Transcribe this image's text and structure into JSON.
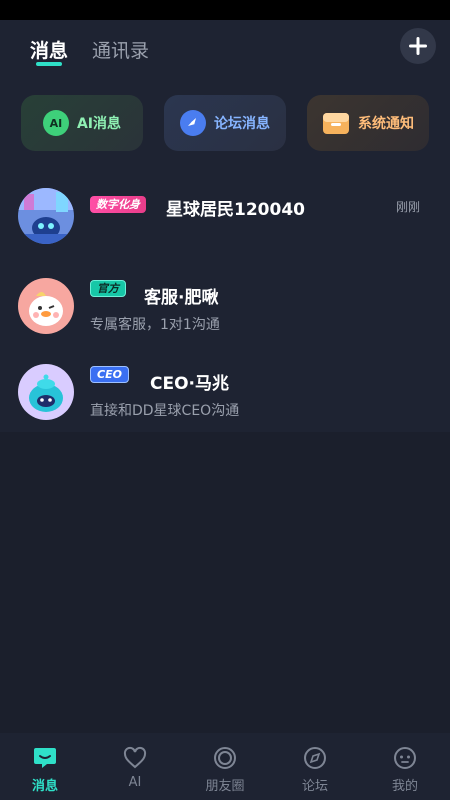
{
  "header": {
    "tabs": [
      {
        "label": "消息",
        "active": true
      },
      {
        "label": "通讯录",
        "active": false
      }
    ]
  },
  "quick_access": [
    {
      "label": "AI消息",
      "icon": "ai-bubble-icon",
      "icon_text": "AI",
      "color": "#8ff0b3"
    },
    {
      "label": "论坛消息",
      "icon": "compass-icon",
      "color": "#86b4ff"
    },
    {
      "label": "系统通知",
      "icon": "inbox-tray-icon",
      "color": "#ffbd7a"
    }
  ],
  "chats": [
    {
      "badge": "数字化身",
      "name": "星球居民120040",
      "preview": "",
      "time": "刚刚",
      "avatar": "robot-avatar"
    },
    {
      "badge": "官方",
      "name": "客服·肥啾",
      "preview": "专属客服，1对1沟通",
      "time": "",
      "avatar": "chick-avatar"
    },
    {
      "badge": "CEO",
      "name": "CEO·马兆",
      "preview": "直接和DD星球CEO沟通",
      "time": "",
      "avatar": "blob-avatar"
    }
  ],
  "bottom_nav": [
    {
      "label": "消息",
      "icon": "chat-bubble-icon",
      "active": true
    },
    {
      "label": "AI",
      "icon": "heart-outline-icon",
      "active": false
    },
    {
      "label": "朋友圈",
      "icon": "ring-icon",
      "active": false
    },
    {
      "label": "论坛",
      "icon": "compass-icon",
      "active": false
    },
    {
      "label": "我的",
      "icon": "smiley-icon",
      "active": false
    }
  ],
  "colors": {
    "accent": "#2fe0c8",
    "background": "#1b1f2c",
    "panel": "#1e2332"
  }
}
